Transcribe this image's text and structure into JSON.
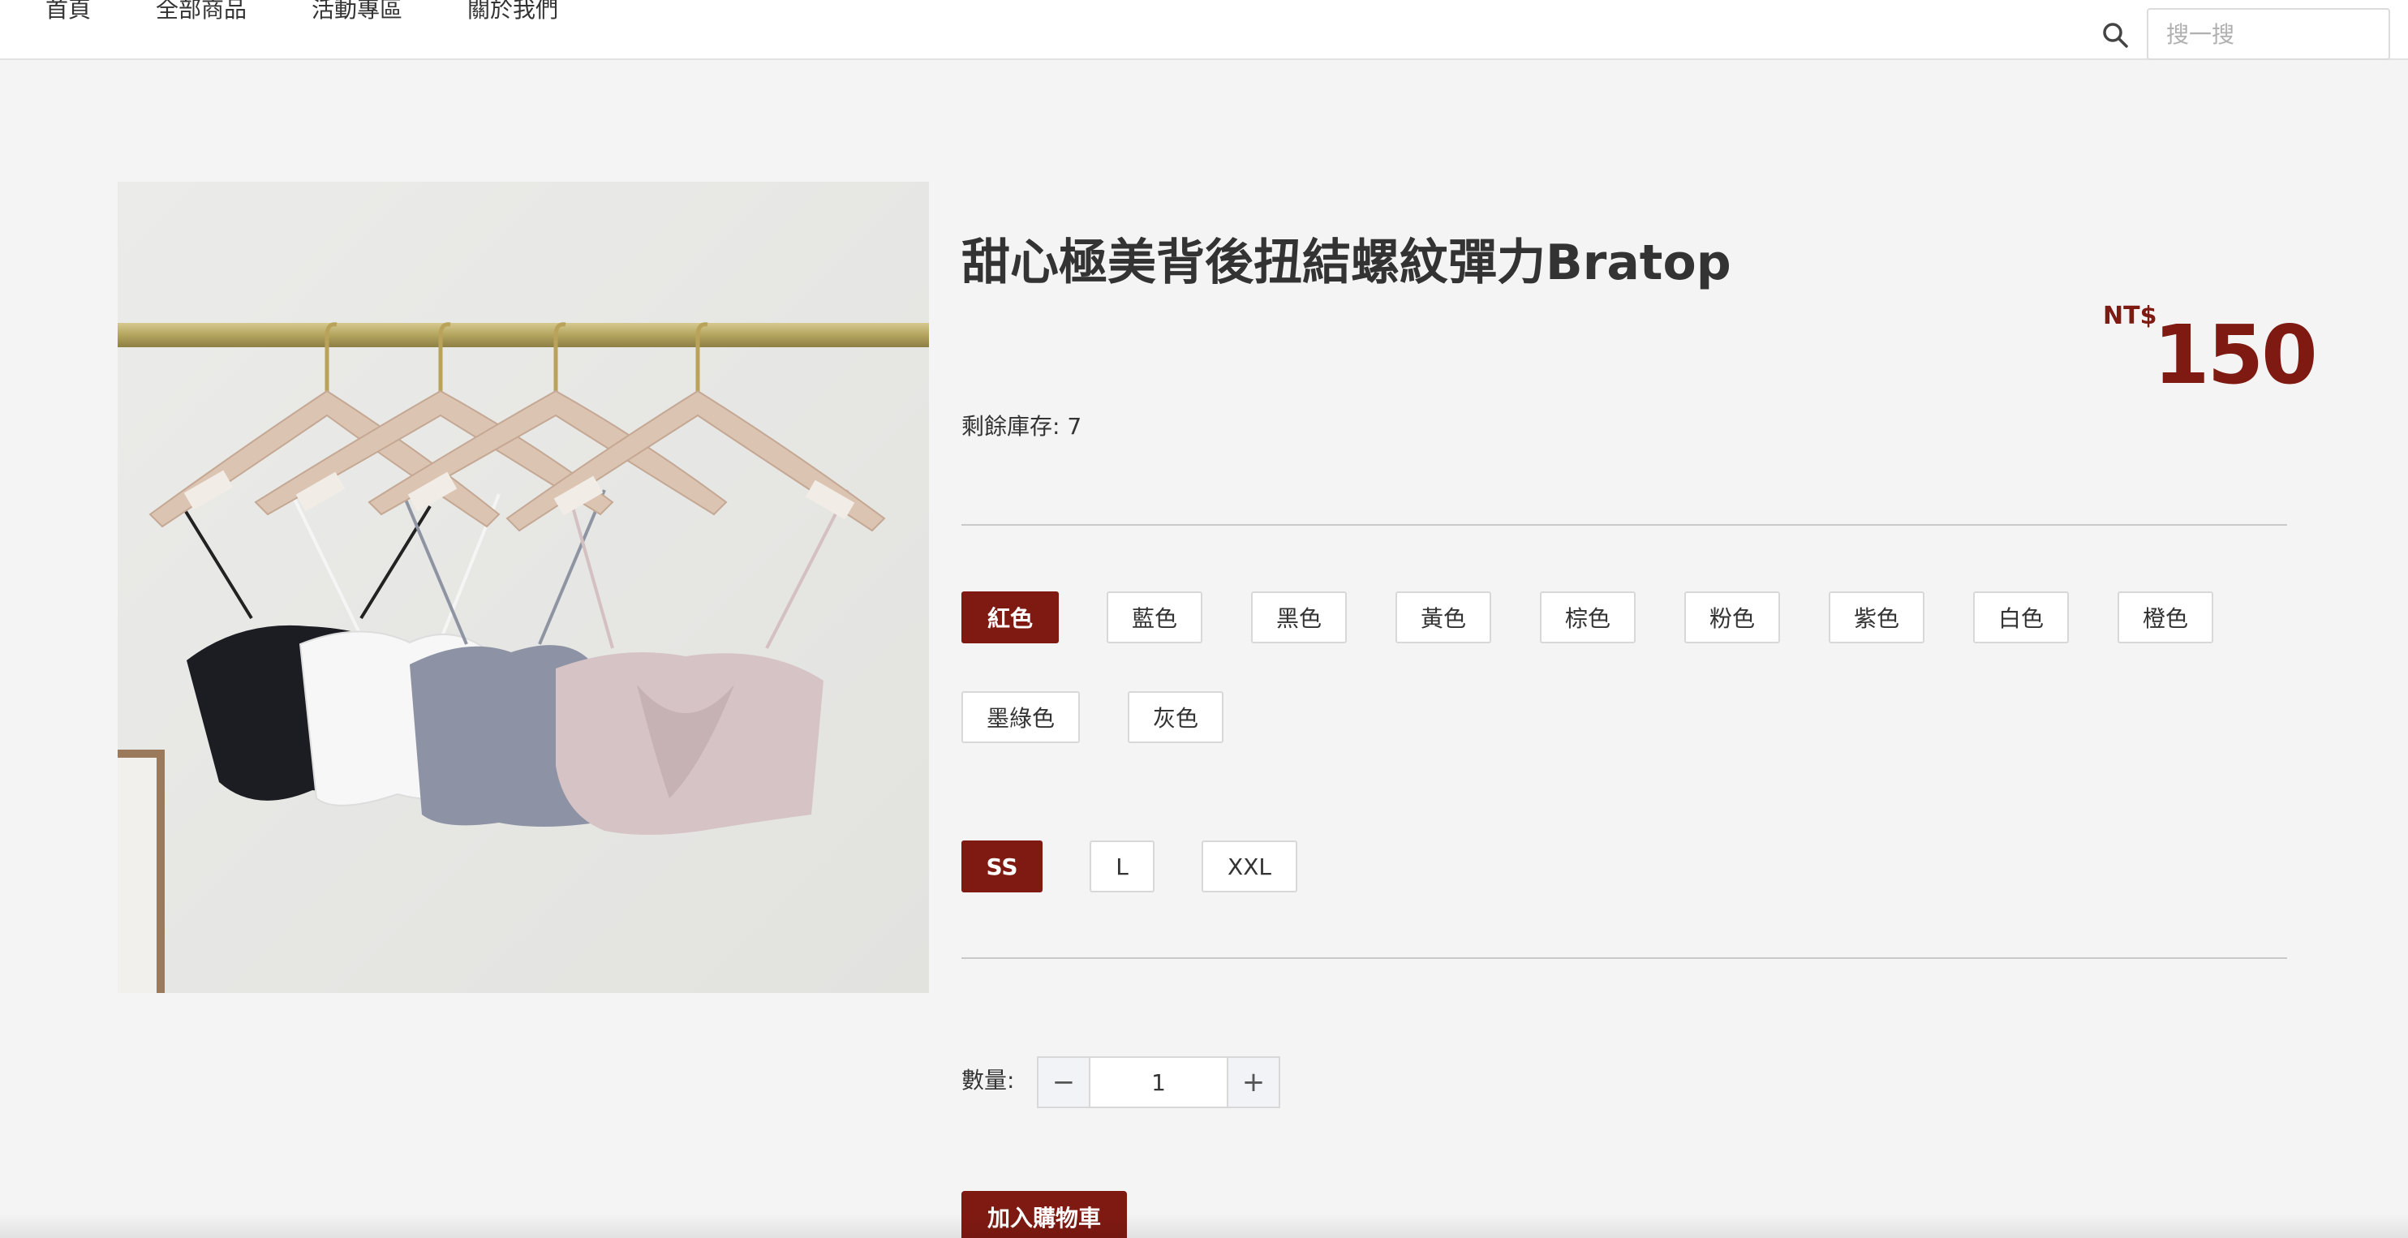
{
  "nav": {
    "items": [
      {
        "label": "首頁"
      },
      {
        "label": "全部商品"
      },
      {
        "label": "活動專區"
      },
      {
        "label": "關於我們"
      }
    ],
    "search_icon": "search-icon",
    "search_placeholder": "搜一搜",
    "search_value": ""
  },
  "product": {
    "title": "甜心極美背後扭結螺紋彈力Bratop",
    "currency": "NT$",
    "price": "150",
    "stock_label": "剩餘庫存:",
    "stock_value": "7",
    "image_alt": "camisole bratops on wooden hangers",
    "colors": [
      {
        "label": "紅色",
        "selected": true
      },
      {
        "label": "藍色",
        "selected": false
      },
      {
        "label": "黑色",
        "selected": false
      },
      {
        "label": "黃色",
        "selected": false
      },
      {
        "label": "棕色",
        "selected": false
      },
      {
        "label": "粉色",
        "selected": false
      },
      {
        "label": "紫色",
        "selected": false
      },
      {
        "label": "白色",
        "selected": false
      },
      {
        "label": "橙色",
        "selected": false
      },
      {
        "label": "墨綠色",
        "selected": false
      },
      {
        "label": "灰色",
        "selected": false
      }
    ],
    "sizes": [
      {
        "label": "SS",
        "selected": true
      },
      {
        "label": "L",
        "selected": false
      },
      {
        "label": "XXL",
        "selected": false
      }
    ],
    "quantity_label": "數量:",
    "quantity_value": "1",
    "quantity_minus": "−",
    "quantity_plus": "+",
    "add_to_cart": "加入購物車"
  },
  "colors": {
    "accent": "#7f1a12",
    "page_bg": "#f4f4f4"
  }
}
